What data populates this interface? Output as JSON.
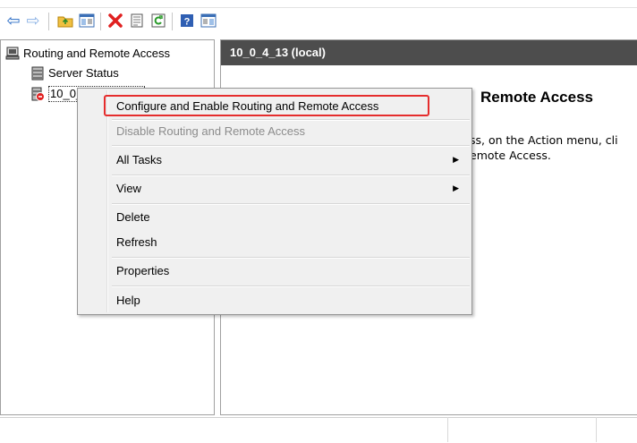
{
  "toolbar": {
    "icons": [
      "back-arrow-icon",
      "forward-arrow-icon",
      "up-folder-icon",
      "show-hide-tree-icon",
      "delete-icon",
      "properties-icon",
      "refresh-icon",
      "help-icon",
      "action-pane-icon"
    ],
    "back_glyph": "⇦",
    "forward_glyph": "⇨"
  },
  "tree": {
    "root_label": "Routing and Remote Access",
    "items": [
      {
        "label": "Server Status"
      },
      {
        "label": "10_0_4_13 (local)"
      }
    ]
  },
  "right_pane": {
    "header": "10_0_4_13 (local)",
    "title_fragment": "Remote Access",
    "text_line1": "ss, on the Action menu, cli",
    "text_line2": "emote Access."
  },
  "context_menu": {
    "items": [
      {
        "label": "Configure and Enable Routing and Remote Access",
        "enabled": true
      },
      {
        "label": "Disable Routing and Remote Access",
        "enabled": false
      },
      {
        "label": "All Tasks",
        "submenu": true
      },
      {
        "label": "View",
        "submenu": true
      },
      {
        "label": "Delete"
      },
      {
        "label": "Refresh"
      },
      {
        "label": "Properties"
      },
      {
        "label": "Help"
      }
    ],
    "submenu_glyph": "▶"
  },
  "colors": {
    "highlight_border": "#e52d2d",
    "pane_header_bg": "#4d4d4d",
    "menu_bg": "#f0f0f0"
  }
}
